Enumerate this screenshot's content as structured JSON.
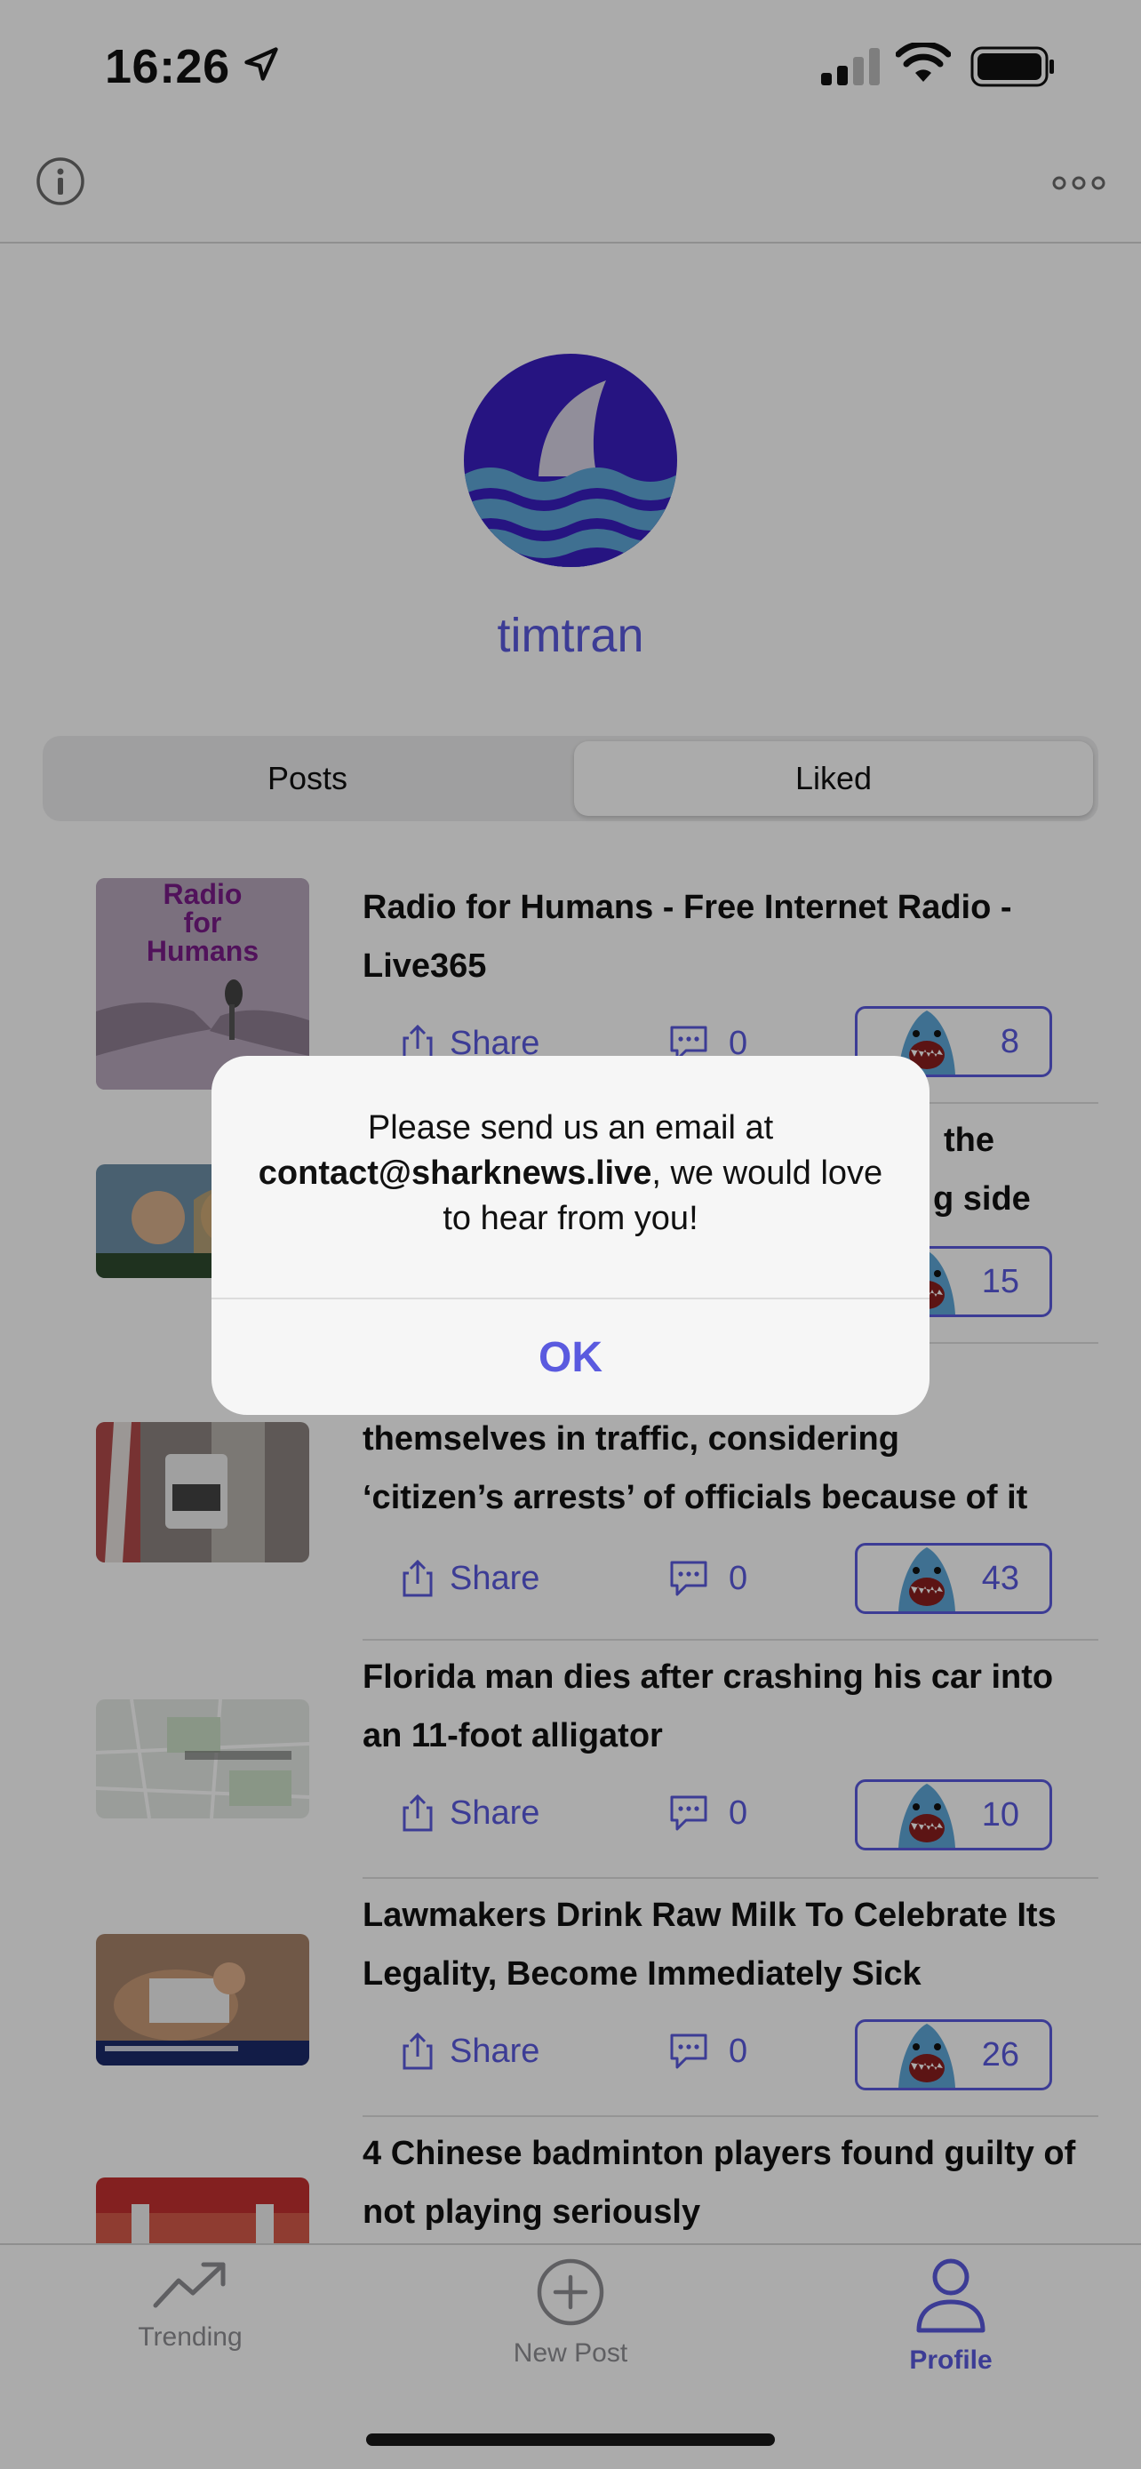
{
  "status_bar": {
    "time": "16:26"
  },
  "profile": {
    "username": "timtran"
  },
  "segments": {
    "posts": "Posts",
    "liked": "Liked",
    "selected": "Liked"
  },
  "thumbnail_text": {
    "radio": "Radio for Humans"
  },
  "posts": [
    {
      "title": "Radio for Humans - Free Internet Radio - Live365",
      "share": "Share",
      "comments": "0",
      "likes": "8"
    },
    {
      "title_visible_end_1": "the",
      "title_visible_end_2": "g side",
      "likes": "15"
    },
    {
      "title_line_2": "themselves in traffic, considering",
      "title_line_3": "‘citizen’s arrests’ of officials because of it",
      "share": "Share",
      "comments": "0",
      "likes": "43"
    },
    {
      "title": "Florida man dies after crashing his car into an 11-foot alligator",
      "share": "Share",
      "comments": "0",
      "likes": "10"
    },
    {
      "title": "Lawmakers Drink Raw Milk To Celebrate Its Legality, Become Immediately Sick",
      "share": "Share",
      "comments": "0",
      "likes": "26"
    },
    {
      "title": "4 Chinese badminton players found guilty of not playing seriously"
    }
  ],
  "tabbar": {
    "trending": "Trending",
    "new_post": "New Post",
    "profile": "Profile",
    "active": "Profile"
  },
  "alert": {
    "message_prefix": "Please send us an email at",
    "email": "contact@sharknews.live",
    "message_suffix": ", we would love to hear from you!",
    "ok": "OK"
  },
  "colors": {
    "accent": "#5a5adf",
    "avatar_bg": "#3a1fc0",
    "shark": "#5ea7d8"
  },
  "icons": [
    "location-arrow-icon",
    "signal-icon",
    "wifi-icon",
    "battery-icon",
    "info-icon",
    "more-icon",
    "share-icon",
    "comment-icon",
    "shark-icon",
    "trending-icon",
    "plus-circle-icon",
    "person-icon"
  ]
}
